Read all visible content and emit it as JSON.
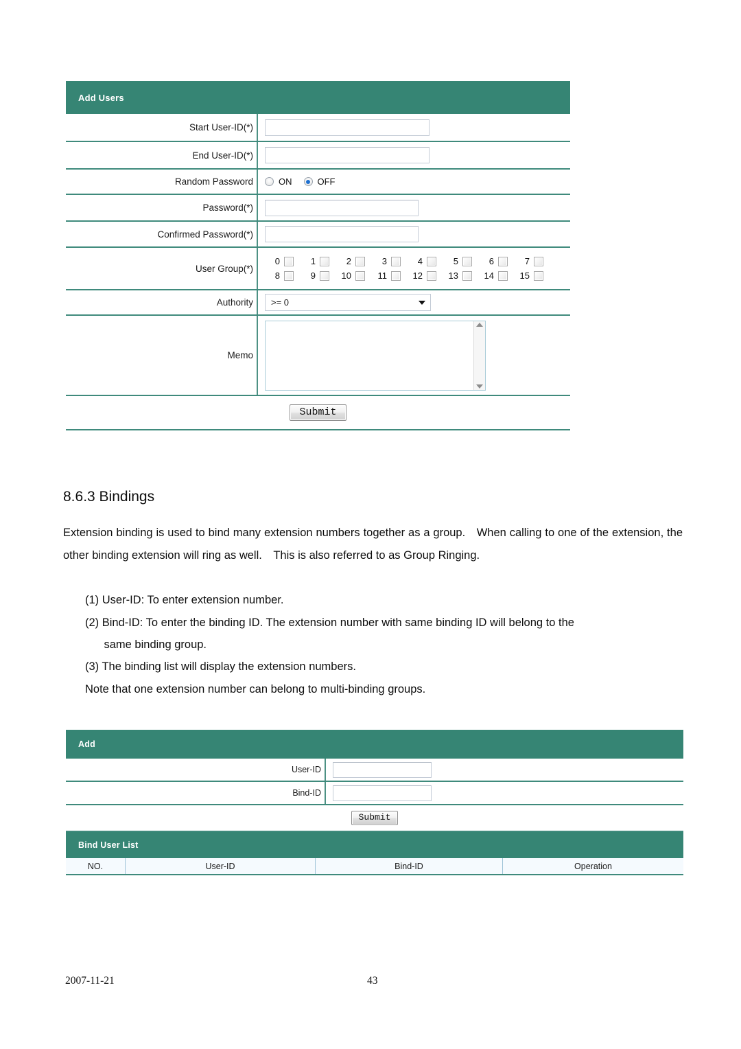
{
  "theme": {
    "header_green": "#368574",
    "row_divider": "#3f8a7c",
    "list_head_bg": "#f5fafe",
    "radio_dot": "#1c6fd0"
  },
  "add_users_panel": {
    "title": "Add Users",
    "rows": [
      {
        "label": "Start User-ID(*)",
        "type": "text",
        "value": "",
        "placeholder": ""
      },
      {
        "label": "End User-ID(*)",
        "type": "text",
        "value": "",
        "placeholder": ""
      },
      {
        "label": "Random Password",
        "type": "radio"
      },
      {
        "label": "Password(*)",
        "type": "text",
        "value": "",
        "placeholder": ""
      },
      {
        "label": "Confirmed Password(*)",
        "type": "text",
        "value": "",
        "placeholder": ""
      },
      {
        "label": "User Group(*)",
        "type": "checkboxes"
      },
      {
        "label": "Authority",
        "type": "select"
      },
      {
        "label": "Memo",
        "type": "textarea"
      }
    ],
    "random_password": {
      "options": [
        {
          "label": "ON",
          "checked": false
        },
        {
          "label": "OFF",
          "checked": true
        }
      ]
    },
    "user_group": {
      "row1": [
        "0",
        "1",
        "2",
        "3",
        "4",
        "5",
        "6",
        "7"
      ],
      "row2": [
        "8",
        "9",
        "10",
        "11",
        "12",
        "13",
        "14",
        "15"
      ],
      "checked": []
    },
    "authority": {
      "selected": ">= 0",
      "options": [
        ">= 0"
      ]
    },
    "memo": {
      "value": "",
      "placeholder": ""
    },
    "submit_label": "Submit"
  },
  "document": {
    "heading": "8.6.3 Bindings",
    "paragraph": "Extension binding is used to bind many extension numbers together as a group. When calling to one of the extension, the other binding extension will ring as well. This is also referred to as Group Ringing.",
    "items": [
      "(1) User-ID: To enter extension number.",
      "(2) Bind-ID: To enter the binding ID. The extension number with same binding ID will belong to the",
      "      same binding group.",
      "(3) The binding list will display the extension numbers."
    ],
    "note": "Note that one extension number can belong to multi-binding groups."
  },
  "add_panel": {
    "title": "Add",
    "rows": [
      {
        "label": "User-ID",
        "value": "",
        "placeholder": ""
      },
      {
        "label": "Bind-ID",
        "value": "",
        "placeholder": ""
      }
    ],
    "submit_label": "Submit"
  },
  "bind_user_list": {
    "title": "Bind User List",
    "columns": [
      "NO.",
      "User-ID",
      "Bind-ID",
      "Operation"
    ],
    "rows": []
  },
  "footer": {
    "date": "2007-11-21",
    "page_number": "43"
  }
}
